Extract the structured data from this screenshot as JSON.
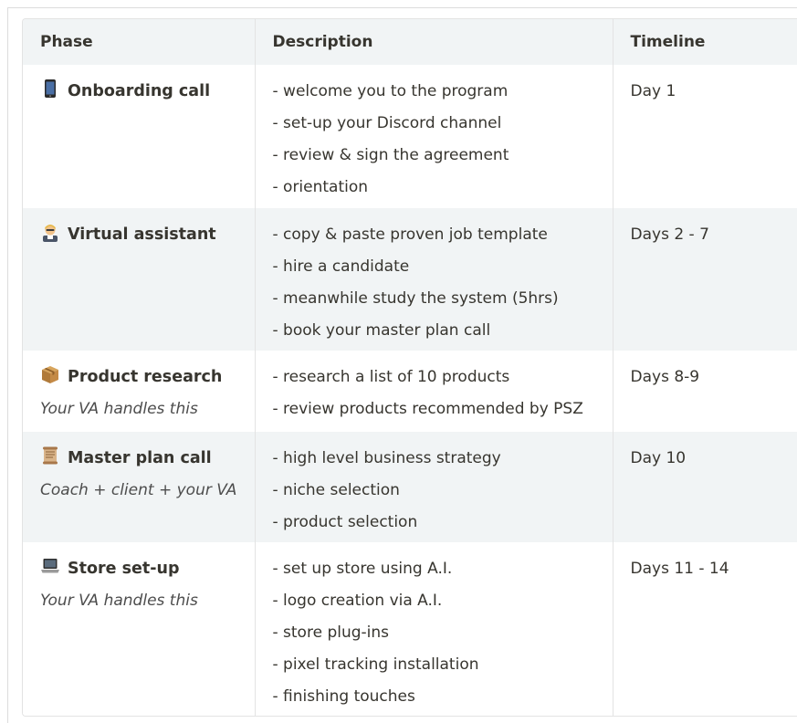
{
  "headers": {
    "phase": "Phase",
    "description": "Description",
    "timeline": "Timeline"
  },
  "rows": [
    {
      "icon": "mobile-phone-icon",
      "title": "Onboarding call",
      "subtitle": "",
      "items": [
        "- welcome you to the program",
        "- set-up your Discord channel",
        "- review & sign the agreement",
        "- orientation"
      ],
      "timeline": "Day 1"
    },
    {
      "icon": "office-worker-icon",
      "title": "Virtual assistant",
      "subtitle": "",
      "items": [
        "- copy & paste proven job template",
        "- hire a candidate",
        "- meanwhile study the system (5hrs)",
        "- book your master plan call"
      ],
      "timeline": "Days 2 - 7"
    },
    {
      "icon": "package-icon",
      "title": "Product research",
      "subtitle": "Your VA handles this",
      "items": [
        "- research a list of 10 products",
        "- review products recommended by PSZ"
      ],
      "timeline": "Days 8-9"
    },
    {
      "icon": "scroll-icon",
      "title": "Master plan call",
      "subtitle": "Coach + client + your VA",
      "items": [
        "- high level business strategy",
        "- niche selection",
        "- product selection"
      ],
      "timeline": "Day 10"
    },
    {
      "icon": "laptop-icon",
      "title": "Store set-up",
      "subtitle": "Your VA handles this",
      "items": [
        "- set up store using A.I.",
        "- logo creation via A.I.",
        "- store plug-ins",
        "- pixel tracking installation",
        "- finishing touches"
      ],
      "timeline": "Days 11 - 14"
    }
  ]
}
